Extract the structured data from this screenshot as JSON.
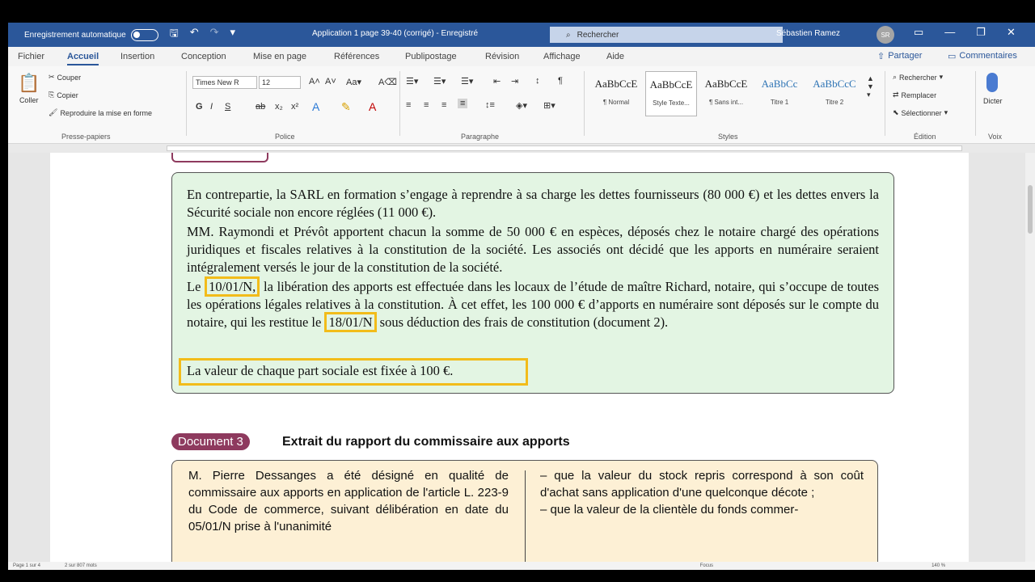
{
  "titlebar": {
    "autosave_label": "Enregistrement automatique",
    "title": "Application 1 page 39-40 (corrigé) - Enregistré",
    "search_placeholder": "Rechercher",
    "user_name": "Sébastien Ramez",
    "user_initials": "SR"
  },
  "menu": {
    "tabs": [
      "Fichier",
      "Accueil",
      "Insertion",
      "Conception",
      "Mise en page",
      "Références",
      "Publipostage",
      "Révision",
      "Affichage",
      "Aide"
    ],
    "share_label": "Partager",
    "comments_label": "Commentaires"
  },
  "ribbon": {
    "clipboard": {
      "paste": "Coller",
      "cut": "Couper",
      "copy": "Copier",
      "format_painter": "Reproduire la mise en forme",
      "label": "Presse-papiers"
    },
    "font": {
      "name": "Times New R",
      "size": "12",
      "label": "Police"
    },
    "paragraph": {
      "label": "Paragraphe"
    },
    "styles": {
      "label": "Styles",
      "items": [
        {
          "sample": "AaBbCcE",
          "name": "¶ Normal"
        },
        {
          "sample": "AaBbCcE",
          "name": "Style Texte..."
        },
        {
          "sample": "AaBbCcE",
          "name": "¶ Sans int..."
        },
        {
          "sample": "AaBbCc",
          "name": "Titre 1"
        },
        {
          "sample": "AaBbCcC",
          "name": "Titre 2"
        }
      ]
    },
    "editing": {
      "find": "Rechercher",
      "replace": "Remplacer",
      "select": "Sélectionner",
      "label": "Édition"
    },
    "voice": {
      "dictate": "Dicter",
      "label": "Voix"
    }
  },
  "document": {
    "box2": {
      "p1": "En contrepartie, la SARL en formation s’engage à reprendre à sa charge les dettes fournisseurs (80 000 €) et les dettes envers la Sécurité sociale non encore réglées (11 000 €).",
      "p2": "MM. Raymondi et Prévôt apportent chacun la somme de 50 000 € en espèces, déposés chez le notaire chargé des opérations juridiques et fiscales relatives à la constitution de la société. Les associés ont décidé que les apports en numéraire seraient intégralement versés le jour de la constitution de la société.",
      "p3_a": "Le",
      "p3_date1": "10/01/N,",
      "p3_b": "la libération des apports est effectuée dans les locaux de l’étude de maître Richard, notaire, qui s’occupe de toutes les opérations légales relatives à la constitution. À cet effet, les 100 000 € d’apports en numéraire sont déposés sur le compte du notaire, qui les restitue le",
      "p3_date2": "18/01/N",
      "p3_c": "sous déduction des frais de constitution (document 2).",
      "p4": "La valeur de chaque part sociale est fixée à 100 €."
    },
    "doc3": {
      "badge": "Document 3",
      "heading": "Extrait du rapport du commissaire aux apports",
      "col1": "M. Pierre Dessanges a été désigné en qualité de commissaire aux apports en application de l'article L. 223-9 du Code de commerce, suivant délibération en date du 05/01/N prise à l'unanimité",
      "col2": "– que la valeur du stock repris correspond à son coût d'achat sans application d'une quelconque décote ;\n– que la valeur de la clientèle du fonds commer-"
    }
  },
  "status": {
    "page": "Page 1 sur 4",
    "words": "2 sur 807 mots",
    "focus": "Focus",
    "zoom": "140 %"
  }
}
